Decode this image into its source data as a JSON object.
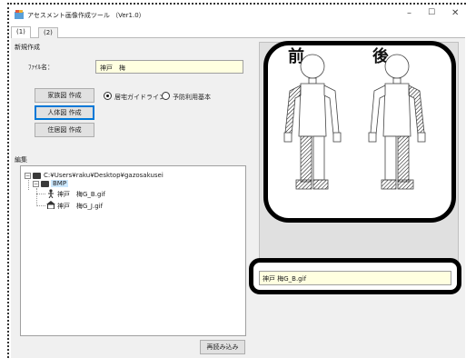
{
  "window": {
    "title": "アセスメント画像作成ツール （Ver1.0）",
    "minimize": "–",
    "maximize": "☐",
    "close": "✕"
  },
  "tabs": [
    {
      "label": "(1)",
      "active": true
    },
    {
      "label": "(2)",
      "active": false
    }
  ],
  "new_section": {
    "label": "新規作成",
    "filename_label": "ﾌｧｲﾙ名：",
    "filename_value": "神戸　梅",
    "buttons": {
      "family": "家族図 作成",
      "body": "人体図 作成",
      "house": "住居図 作成"
    },
    "radio": [
      {
        "label": "居宅ガイドライン",
        "checked": true
      },
      {
        "label": "予防利用基本",
        "checked": false
      }
    ]
  },
  "edit_section": {
    "label": "編集",
    "tree": {
      "root": "C:¥Users¥raku¥Desktop¥gazosakusei",
      "folder": "BMP",
      "files": [
        "神戸　梅G_B.gif",
        "神戸　梅G_J.gif"
      ]
    },
    "reload_button": "再読み込み"
  },
  "preview": {
    "front_label": "前",
    "back_label": "後"
  },
  "selected_file": "神戸 梅G_B.gif"
}
